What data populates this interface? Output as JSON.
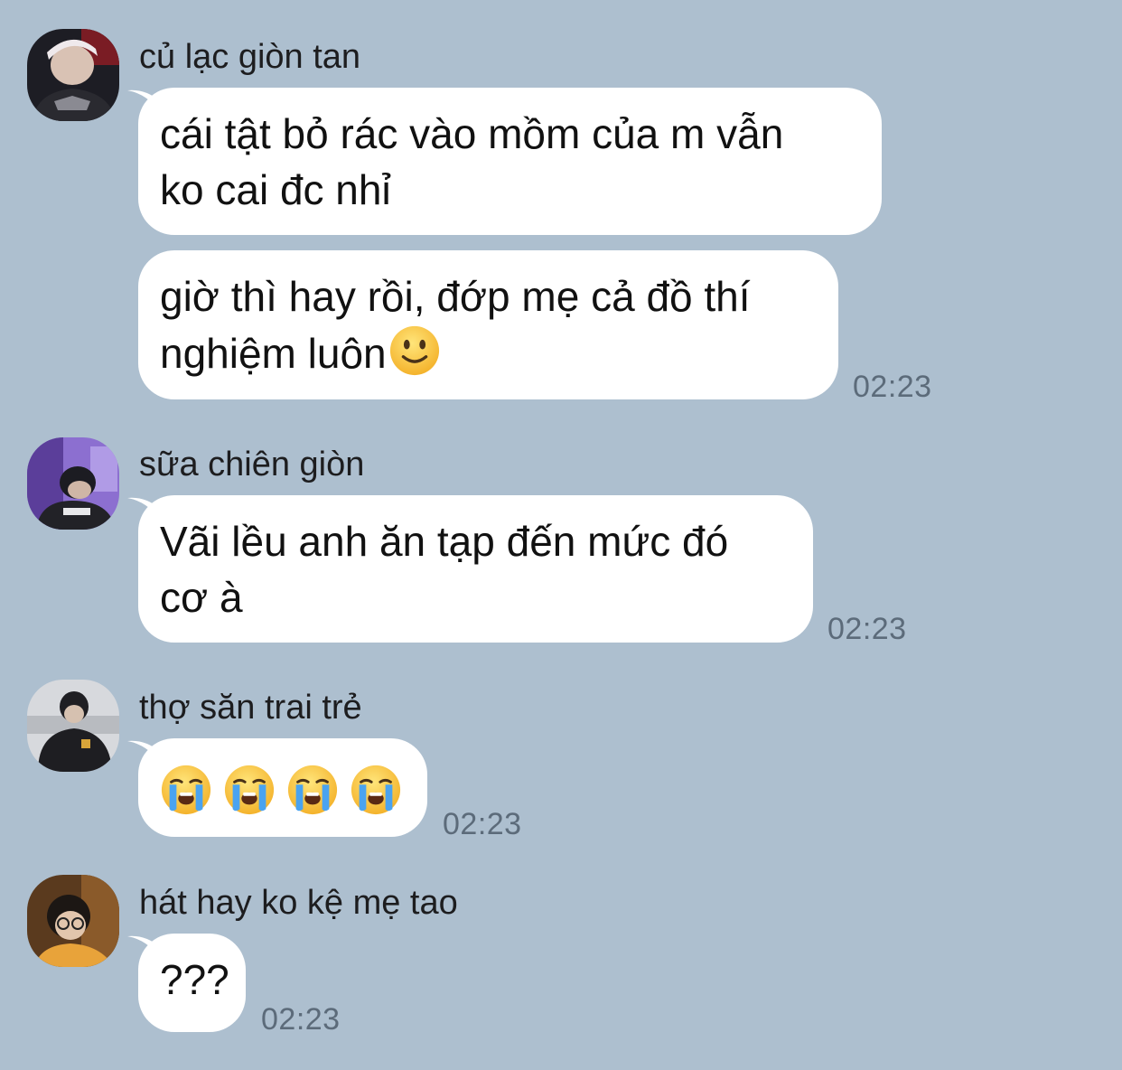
{
  "messages": [
    {
      "sender": "củ lạc giòn tan",
      "bubbles": [
        {
          "lines": [
            "cái tật bỏ rác vào mồm của m vẫn",
            "ko cai đc nhỉ"
          ]
        },
        {
          "lines": [
            "giờ thì hay rồi, đớp mẹ cả đồ thí",
            "nghiệm luôn"
          ],
          "trailing_emoji": "slightly-smiling-face"
        }
      ],
      "time": "02:23"
    },
    {
      "sender": "sữa chiên giòn",
      "bubbles": [
        {
          "lines": [
            "Vãi lều anh ăn tạp đến mức đó",
            "cơ à"
          ]
        }
      ],
      "time": "02:23"
    },
    {
      "sender": "thợ săn trai trẻ",
      "bubbles": [
        {
          "emojis": [
            "loudly-crying-face",
            "loudly-crying-face",
            "loudly-crying-face",
            "loudly-crying-face"
          ]
        }
      ],
      "time": "02:23"
    },
    {
      "sender": "hát hay ko kệ mẹ tao",
      "bubbles": [
        {
          "lines": [
            "???"
          ]
        }
      ],
      "time": "02:23"
    }
  ],
  "colors": {
    "background": "#adbfcf",
    "bubble": "#ffffff",
    "timestamp": "#5c6b7a"
  }
}
